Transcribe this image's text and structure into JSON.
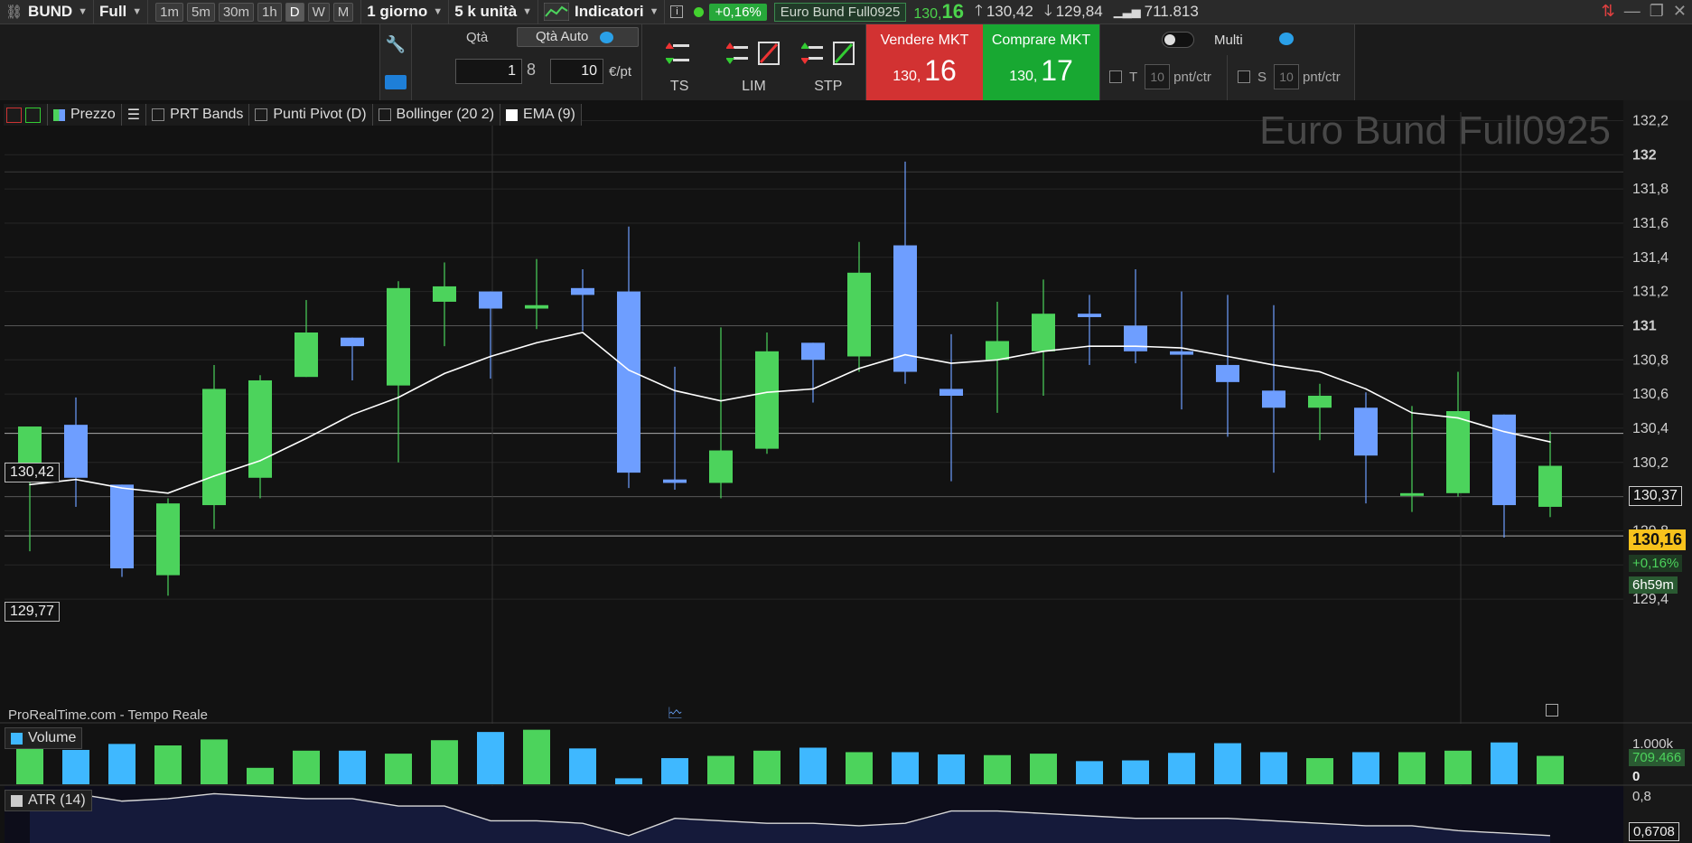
{
  "toolbar": {
    "instrument": "BUND",
    "contract": "Full",
    "timeframes": [
      "1m",
      "5m",
      "30m",
      "1h",
      "D",
      "W",
      "M"
    ],
    "active_timeframe": "D",
    "period": "1 giorno",
    "units": "5 k unità",
    "indicators_label": "Indicatori",
    "change_pct": "+0,16%",
    "instrument_name": "Euro Bund Full0925",
    "last_price_prefix": "130,",
    "last_price_big": "16",
    "high": "130,42",
    "low": "129,84",
    "volume": "711.813"
  },
  "order_panel": {
    "qty_label": "Qtà",
    "qty_auto_label": "Qtà Auto",
    "qty_value": "1",
    "qty_points": "10",
    "unit_label": "€/pt",
    "order_types": [
      "TS",
      "LIM",
      "STP"
    ],
    "sell_label": "Vendere MKT",
    "sell_prefix": "130,",
    "sell_big": "16",
    "buy_label": "Comprare MKT",
    "buy_prefix": "130,",
    "buy_big": "17",
    "multi_label": "Multi",
    "target_label": "T",
    "stop_label": "S",
    "pnt_value": "10",
    "pnt_unit": "pnt/ctr"
  },
  "legend": {
    "price": "Prezzo",
    "prt_bands": "PRT Bands",
    "pivot": "Punti Pivot (D)",
    "bollinger": "Bollinger (20 2)",
    "ema": "EMA (9)"
  },
  "watermark": "Euro Bund Full0925",
  "price_labels": {
    "high": "130,42",
    "low": "129,77"
  },
  "axis_tags": {
    "level": "130,37",
    "last": "130,16",
    "change": "+0,16%",
    "countdown": "6h59m",
    "volume_last": "709.466",
    "atr_last": "0,6708"
  },
  "brand": "ProRealTime.com - Tempo Reale",
  "volume_label": "Volume",
  "atr_label": "ATR (14)",
  "colors": {
    "bull": "#4cd35c",
    "bear": "#6e9eff",
    "ema": "#ffffff",
    "vol_bull": "#4cd35c",
    "vol_bear": "#3fb8ff",
    "last_tag": "#f8c21c"
  },
  "chart_data": {
    "type": "candlestick",
    "y_ticks": [
      "132,2",
      "132",
      "131,8",
      "131,6",
      "131,4",
      "131,2",
      "131",
      "130,8",
      "130,6",
      "130,4",
      "130,2",
      "130",
      "129,8",
      "129,6",
      "129,4"
    ],
    "ylim": [
      129.3,
      132.25
    ],
    "candles": [
      {
        "o": 130.13,
        "h": 130.3,
        "l": 129.68,
        "c": 130.41
      },
      {
        "o": 130.42,
        "h": 130.58,
        "l": 129.94,
        "c": 130.11
      },
      {
        "o": 130.07,
        "h": 130.07,
        "l": 129.53,
        "c": 129.58
      },
      {
        "o": 129.54,
        "h": 129.99,
        "l": 129.42,
        "c": 129.96
      },
      {
        "o": 129.95,
        "h": 130.77,
        "l": 129.81,
        "c": 130.63
      },
      {
        "o": 130.11,
        "h": 130.71,
        "l": 129.99,
        "c": 130.68
      },
      {
        "o": 130.7,
        "h": 131.15,
        "l": 130.7,
        "c": 130.96
      },
      {
        "o": 130.93,
        "h": 130.93,
        "l": 130.68,
        "c": 130.88
      },
      {
        "o": 130.65,
        "h": 131.26,
        "l": 130.2,
        "c": 131.22
      },
      {
        "o": 131.14,
        "h": 131.37,
        "l": 130.88,
        "c": 131.23
      },
      {
        "o": 131.2,
        "h": 131.2,
        "l": 130.69,
        "c": 131.1
      },
      {
        "o": 131.1,
        "h": 131.39,
        "l": 130.98,
        "c": 131.12
      },
      {
        "o": 131.22,
        "h": 131.33,
        "l": 130.97,
        "c": 131.18
      },
      {
        "o": 131.2,
        "h": 131.58,
        "l": 130.05,
        "c": 130.14
      },
      {
        "o": 130.1,
        "h": 130.76,
        "l": 130.04,
        "c": 130.08
      },
      {
        "o": 130.08,
        "h": 130.99,
        "l": 129.99,
        "c": 130.27
      },
      {
        "o": 130.28,
        "h": 130.96,
        "l": 130.25,
        "c": 130.85
      },
      {
        "o": 130.9,
        "h": 130.9,
        "l": 130.55,
        "c": 130.8
      },
      {
        "o": 130.82,
        "h": 131.49,
        "l": 130.73,
        "c": 131.31
      },
      {
        "o": 131.47,
        "h": 131.96,
        "l": 130.66,
        "c": 130.73
      },
      {
        "o": 130.63,
        "h": 130.95,
        "l": 130.09,
        "c": 130.59
      },
      {
        "o": 130.8,
        "h": 131.14,
        "l": 130.49,
        "c": 130.91
      },
      {
        "o": 130.85,
        "h": 131.27,
        "l": 130.59,
        "c": 131.07
      },
      {
        "o": 131.07,
        "h": 131.18,
        "l": 130.77,
        "c": 131.05
      },
      {
        "o": 131.0,
        "h": 131.33,
        "l": 130.78,
        "c": 130.85
      },
      {
        "o": 130.85,
        "h": 131.2,
        "l": 130.51,
        "c": 130.83
      },
      {
        "o": 130.77,
        "h": 131.18,
        "l": 130.35,
        "c": 130.67
      },
      {
        "o": 130.62,
        "h": 131.12,
        "l": 130.14,
        "c": 130.52
      },
      {
        "o": 130.52,
        "h": 130.66,
        "l": 130.33,
        "c": 130.59
      },
      {
        "o": 130.52,
        "h": 130.61,
        "l": 129.96,
        "c": 130.24
      },
      {
        "o": 130.02,
        "h": 130.53,
        "l": 129.91,
        "c": 130.02
      },
      {
        "o": 130.02,
        "h": 130.73,
        "l": 130.0,
        "c": 130.5
      },
      {
        "o": 130.48,
        "h": 130.48,
        "l": 129.76,
        "c": 129.95
      },
      {
        "o": 129.94,
        "h": 130.38,
        "l": 129.88,
        "c": 130.18
      }
    ],
    "ema": [
      130.07,
      130.1,
      130.05,
      130.02,
      130.12,
      130.21,
      130.34,
      130.48,
      130.58,
      130.72,
      130.82,
      130.9,
      130.96,
      130.74,
      130.62,
      130.56,
      130.61,
      130.63,
      130.75,
      130.83,
      130.78,
      130.8,
      130.85,
      130.88,
      130.88,
      130.87,
      130.82,
      130.77,
      130.73,
      130.63,
      130.49,
      130.46,
      130.38,
      130.32
    ],
    "volume": [
      0.56,
      0.46,
      0.54,
      0.52,
      0.6,
      0.22,
      0.45,
      0.45,
      0.41,
      0.59,
      0.7,
      0.73,
      0.48,
      0.08,
      0.35,
      0.38,
      0.45,
      0.49,
      0.43,
      0.43,
      0.4,
      0.39,
      0.41,
      0.31,
      0.32,
      0.42,
      0.55,
      0.43,
      0.35,
      0.43,
      0.43,
      0.45,
      0.56,
      0.38
    ],
    "volume_ticks": [
      "1.000k",
      "0"
    ],
    "atr": [
      0.8,
      0.84,
      0.81,
      0.82,
      0.84,
      0.83,
      0.82,
      0.82,
      0.79,
      0.79,
      0.73,
      0.73,
      0.72,
      0.67,
      0.74,
      0.73,
      0.72,
      0.72,
      0.71,
      0.72,
      0.77,
      0.77,
      0.76,
      0.75,
      0.74,
      0.74,
      0.74,
      0.73,
      0.72,
      0.71,
      0.71,
      0.69,
      0.68,
      0.67
    ],
    "atr_ticks": [
      "0,8"
    ]
  }
}
